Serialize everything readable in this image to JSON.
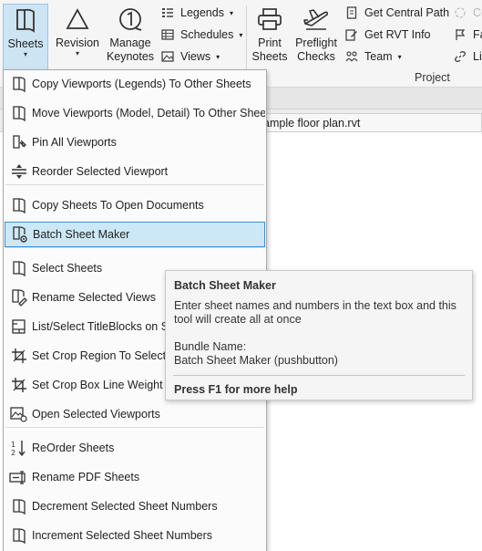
{
  "ribbon": {
    "buttons": {
      "sheets": "Sheets",
      "revision": "Revision",
      "manage_keynotes_1": "Manage",
      "manage_keynotes_2": "Keynotes",
      "print_1": "Print",
      "print_2": "Sheets",
      "preflight_1": "Preflight",
      "preflight_2": "Checks"
    },
    "small_a": [
      "Legends",
      "Schedules",
      "Views"
    ],
    "small_b": [
      "Get Central Path",
      "Get RVT Info",
      "Team"
    ],
    "small_c": [
      "Co",
      "Far",
      "Lin"
    ],
    "panel_label": "Project"
  },
  "document_tab": "ample floor plan.rvt",
  "menu": {
    "items": [
      {
        "label": "Copy Viewports (Legends) To Other Sheets",
        "icon": "sheet-copy-icon"
      },
      {
        "label": "Move Viewports (Model, Detail) To Other Sheets",
        "icon": "sheet-move-icon"
      },
      {
        "label": "Pin All Viewports",
        "icon": "pin-icon"
      },
      {
        "label": "Reorder Selected Viewport",
        "icon": "reorder-icon"
      },
      {
        "label": "Copy Sheets To Open Documents",
        "icon": "sheet-copy-icon"
      },
      {
        "label": "Batch Sheet Maker",
        "icon": "sheet-gear-icon"
      },
      {
        "label": "Select Sheets",
        "icon": "sheet-select-icon"
      },
      {
        "label": "Rename Selected Views",
        "icon": "rename-icon"
      },
      {
        "label": "List/Select TitleBlocks on Sheets",
        "icon": "titleblock-icon"
      },
      {
        "label": "Set Crop Region To Selected",
        "icon": "crop-icon"
      },
      {
        "label": "Set Crop Box Line Weight",
        "icon": "crop-icon"
      },
      {
        "label": "Open Selected Viewports",
        "icon": "open-viewport-icon"
      },
      {
        "label": "ReOrder Sheets",
        "icon": "sort-order-icon"
      },
      {
        "label": "Rename PDF Sheets",
        "icon": "rename-pdf-icon"
      },
      {
        "label": "Decrement Selected Sheet Numbers",
        "icon": "sheet-icon"
      },
      {
        "label": "Increment Selected Sheet Numbers",
        "icon": "sheet-icon"
      }
    ]
  },
  "tooltip": {
    "title": "Batch Sheet Maker",
    "description": "Enter sheet names and numbers in the text box and this tool will create all at once",
    "bundle_label": "Bundle Name:",
    "bundle_value": "Batch Sheet Maker (pushbutton)",
    "help": "Press F1 for more help"
  },
  "colors": {
    "active_bg": "#cce8f7",
    "active_border": "#3b8fd0",
    "sheets_button_bg": "#cde4f3"
  }
}
